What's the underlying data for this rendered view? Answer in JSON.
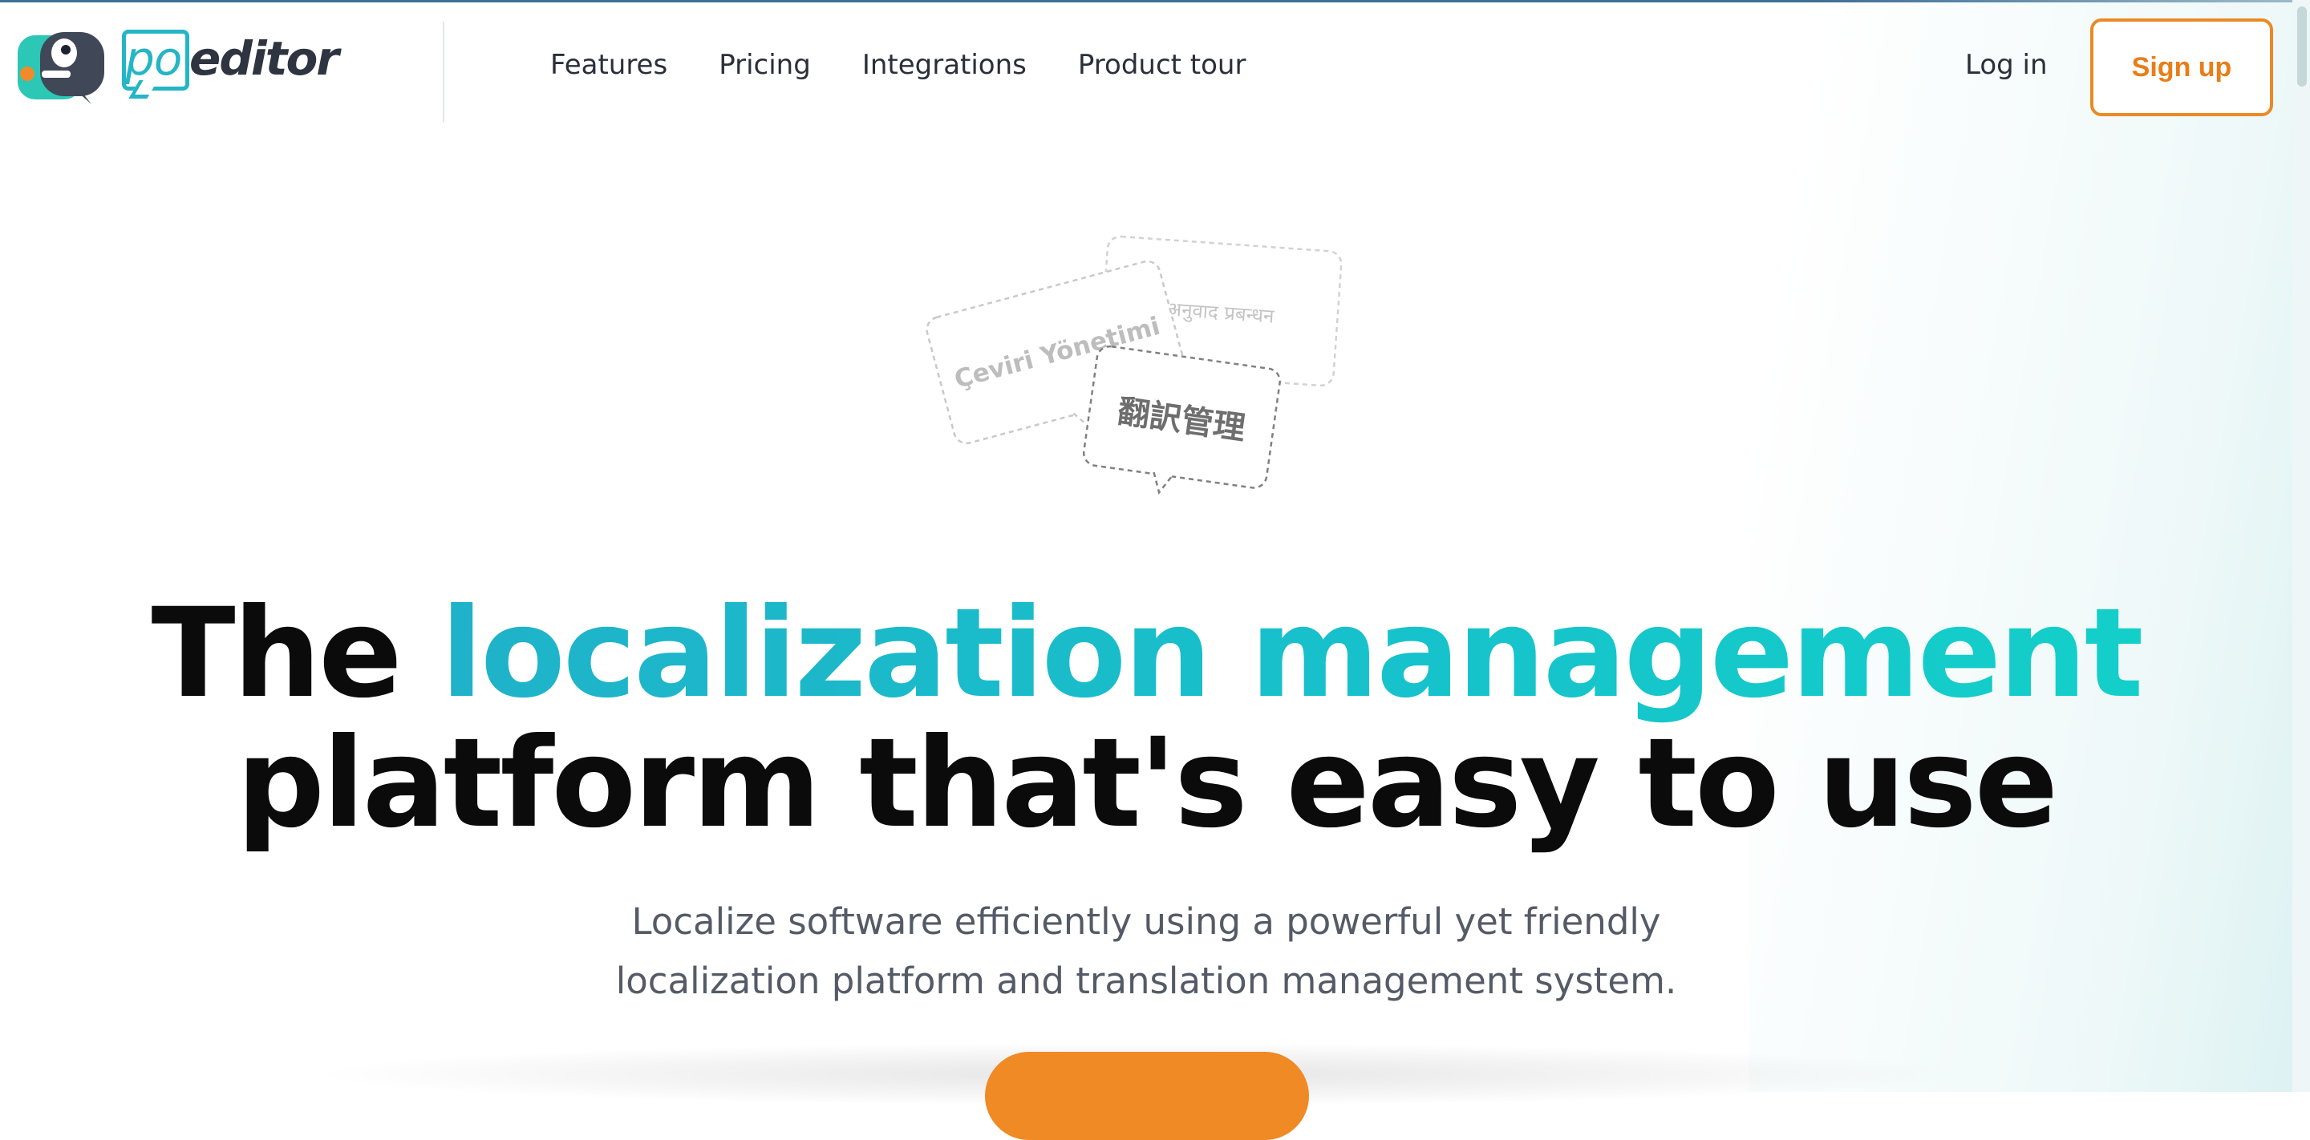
{
  "brand": {
    "logo_po": "po",
    "logo_editor": "editor",
    "colors": {
      "teal": "#24b6c6",
      "dark": "#2e3440",
      "orange": "#ef8a25"
    }
  },
  "nav": {
    "items": [
      "Features",
      "Pricing",
      "Integrations",
      "Product tour"
    ],
    "login": "Log in",
    "signup": "Sign up"
  },
  "bubbles": {
    "turkish": "Çeviri Yönetimi",
    "hindi": "अनुवाद प्रबन्धन",
    "japanese": "翻訳管理"
  },
  "hero": {
    "title_prefix": "The",
    "title_accent": "localization management",
    "title_line2": "platform that's easy to use",
    "subtitle_line1": "Localize software efficiently using a powerful yet friendly",
    "subtitle_line2": "localization platform and translation management system."
  }
}
